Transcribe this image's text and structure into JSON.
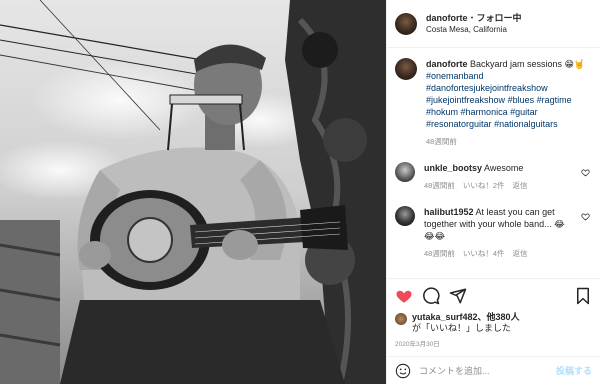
{
  "header": {
    "username": "danoforte",
    "separator": "・",
    "follow_label": "フォロー中",
    "location": "Costa Mesa, California"
  },
  "caption": {
    "username": "danoforte",
    "text": "Backyard jam sessions 😁🤘",
    "hashtags": [
      "#onemanband",
      "#danofortesjukejointfreakshow",
      "#jukejointfreakshow",
      "#blues",
      "#ragtime",
      "#hokum",
      "#harmonica",
      "#guitar",
      "#resonatorguitar",
      "#nationalguitars"
    ],
    "time": "48週間前"
  },
  "comments": [
    {
      "username": "unkle_bootsy",
      "text": "Awesome",
      "time": "48週間前",
      "likes": "いいね！2件",
      "reply": "返信"
    },
    {
      "username": "halibut1952",
      "text": "At least you can get together with your whole band... 😂😂😂",
      "time": "48週間前",
      "likes": "いいね！4件",
      "reply": "返信"
    }
  ],
  "likes": {
    "user": "yutaka_surf482",
    "rest": "、他380人",
    "line2": "が「いいね！」しました"
  },
  "date": "2020年3月30日",
  "add_comment": {
    "placeholder": "コメントを追加...",
    "post_label": "投稿する"
  },
  "icons": {
    "like": "heart-filled-icon",
    "comment": "comment-icon",
    "share": "share-icon",
    "save": "bookmark-icon",
    "emoji": "smile-icon"
  },
  "colors": {
    "like_red": "#ed4956",
    "link_blue": "#00376b",
    "post_btn": "#b2dffc",
    "meta_gray": "#8e8e8e"
  }
}
